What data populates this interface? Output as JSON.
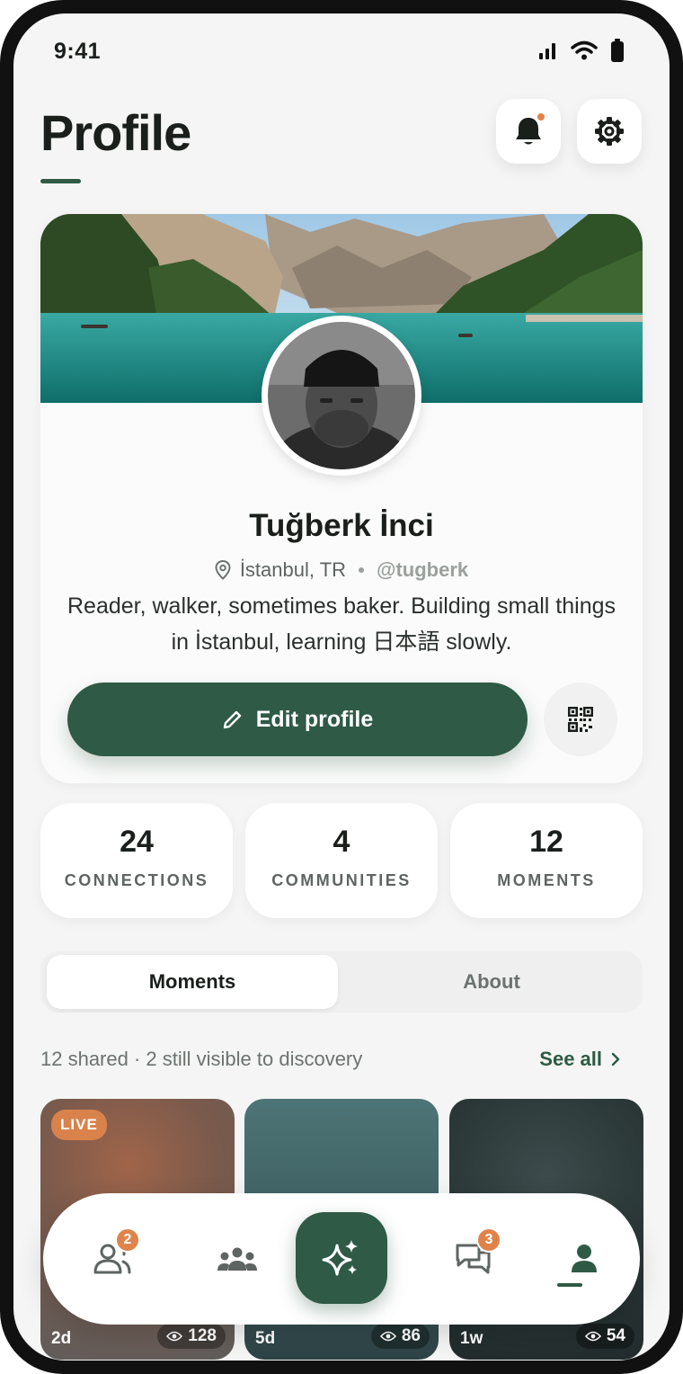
{
  "status_bar": {
    "time": "9:41"
  },
  "header": {
    "title": "Profile",
    "has_notification": true
  },
  "profile": {
    "name": "Tuğberk İnci",
    "location": "İstanbul, TR",
    "handle": "@tugberk",
    "bio": "Reader, walker, sometimes baker. Building small things in İstanbul, learning 日本語 slowly.",
    "edit_button_label": "Edit profile"
  },
  "stats": [
    {
      "value": "24",
      "label": "CONNECTIONS"
    },
    {
      "value": "4",
      "label": "COMMUNITIES"
    },
    {
      "value": "12",
      "label": "MOMENTS"
    }
  ],
  "tabs": [
    {
      "label": "Moments",
      "active": true
    },
    {
      "label": "About",
      "active": false
    }
  ],
  "moments_section": {
    "info": "12 shared · 2 still visible to discovery",
    "see_all_label": "See all"
  },
  "moments": [
    {
      "badge": "LIVE",
      "age": "2d",
      "views": "128"
    },
    {
      "age": "5d",
      "views": "86"
    },
    {
      "age": "1w",
      "views": "54"
    }
  ],
  "bottom_nav": {
    "items": [
      {
        "name": "connections",
        "badge": "2"
      },
      {
        "name": "communities"
      },
      {
        "name": "create-moment"
      },
      {
        "name": "messages",
        "badge": "3"
      },
      {
        "name": "profile",
        "active": true
      }
    ]
  },
  "colors": {
    "accent": "#2f5a45",
    "notification": "#e0834b",
    "background": "#f4f5f4"
  }
}
